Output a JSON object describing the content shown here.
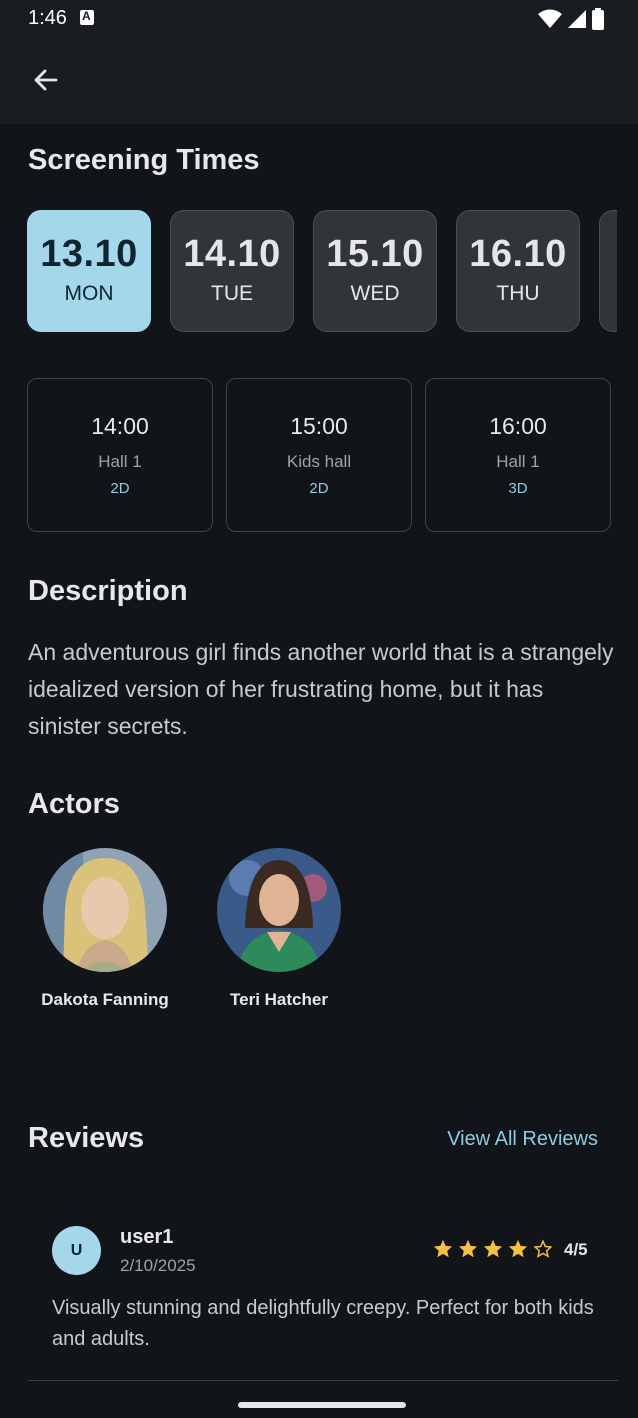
{
  "status_bar": {
    "time": "1:46"
  },
  "sections": {
    "screening_title": "Screening Times",
    "description_title": "Description",
    "actors_title": "Actors",
    "reviews_title": "Reviews"
  },
  "dates": [
    {
      "date": "13.10",
      "day": "MON",
      "selected": true
    },
    {
      "date": "14.10",
      "day": "TUE",
      "selected": false
    },
    {
      "date": "15.10",
      "day": "WED",
      "selected": false
    },
    {
      "date": "16.10",
      "day": "THU",
      "selected": false
    }
  ],
  "times": [
    {
      "time": "14:00",
      "hall": "Hall 1",
      "format": "2D"
    },
    {
      "time": "15:00",
      "hall": "Kids hall",
      "format": "2D"
    },
    {
      "time": "16:00",
      "hall": "Hall 1",
      "format": "3D"
    }
  ],
  "description": "An adventurous girl finds another world that is a strangely idealized version of her frustrating home, but it has sinister secrets.",
  "actors": [
    {
      "name": "Dakota Fanning"
    },
    {
      "name": "Teri Hatcher"
    }
  ],
  "reviews": {
    "view_all_label": "View All Reviews",
    "items": [
      {
        "avatar_letter": "U",
        "user": "user1",
        "date": "2/10/2025",
        "rating": 4,
        "rating_text": "4/5",
        "text": "Visually stunning and delightfully creepy. Perfect for both kids and adults."
      }
    ]
  },
  "colors": {
    "accent": "#a5d7ea",
    "star": "#f5c043",
    "background": "#111418"
  }
}
